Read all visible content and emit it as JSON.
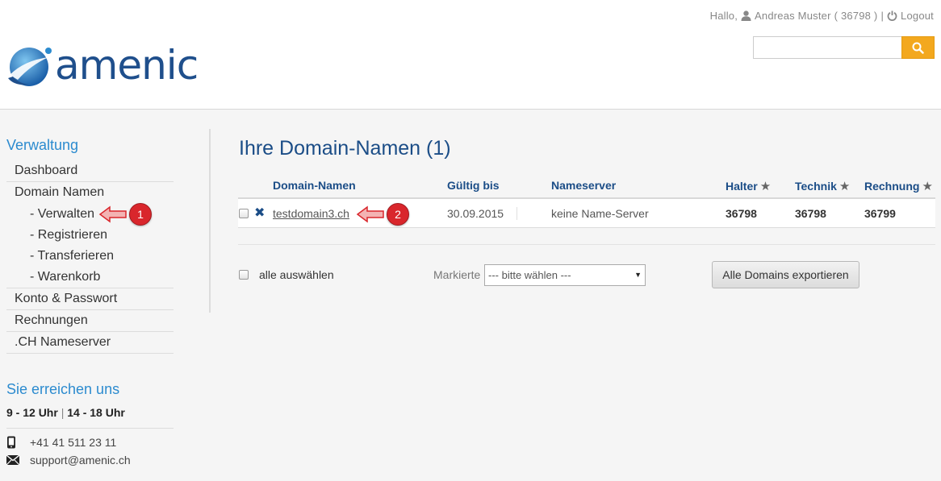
{
  "header": {
    "greeting": "Hallo,",
    "user_name": "Andreas Muster",
    "user_id": "( 36798 )",
    "separator": "|",
    "logout_label": "Logout",
    "logo_text": "amenic",
    "search_value": "",
    "accent_color": "#f3a81e"
  },
  "sidebar": {
    "title": "Verwaltung",
    "items": [
      {
        "label": "Dashboard"
      },
      {
        "label": "Domain Namen",
        "sub": [
          "- Verwalten",
          "- Registrieren",
          "- Transferieren",
          "- Warenkorb"
        ]
      },
      {
        "label": "Konto & Passwort"
      },
      {
        "label": "Rechnungen"
      },
      {
        "label": ".CH Nameserver"
      }
    ],
    "contact_title": "Sie erreichen uns",
    "hours_1": "9 - 12 Uhr",
    "hours_sep": "|",
    "hours_2": "14 - 18 Uhr",
    "phone": "+41 41 511 23 11",
    "email": "support@amenic.ch"
  },
  "main": {
    "title": "Ihre Domain-Namen (1)",
    "columns": [
      "Domain-Namen",
      "Gültig bis",
      "Nameserver",
      "Halter",
      "Technik",
      "Rechnung"
    ],
    "rows": [
      {
        "domain": "testdomain3.ch",
        "valid_until": "30.09.2015",
        "nameserver": "keine Name-Server",
        "holder": "36798",
        "tech": "36798",
        "billing": "36799"
      }
    ],
    "select_all_label": "alle auswählen",
    "marked_label": "Markierte",
    "select_placeholder": "--- bitte wählen ---",
    "export_label": "Alle Domains exportieren"
  },
  "callouts": [
    "1",
    "2"
  ]
}
